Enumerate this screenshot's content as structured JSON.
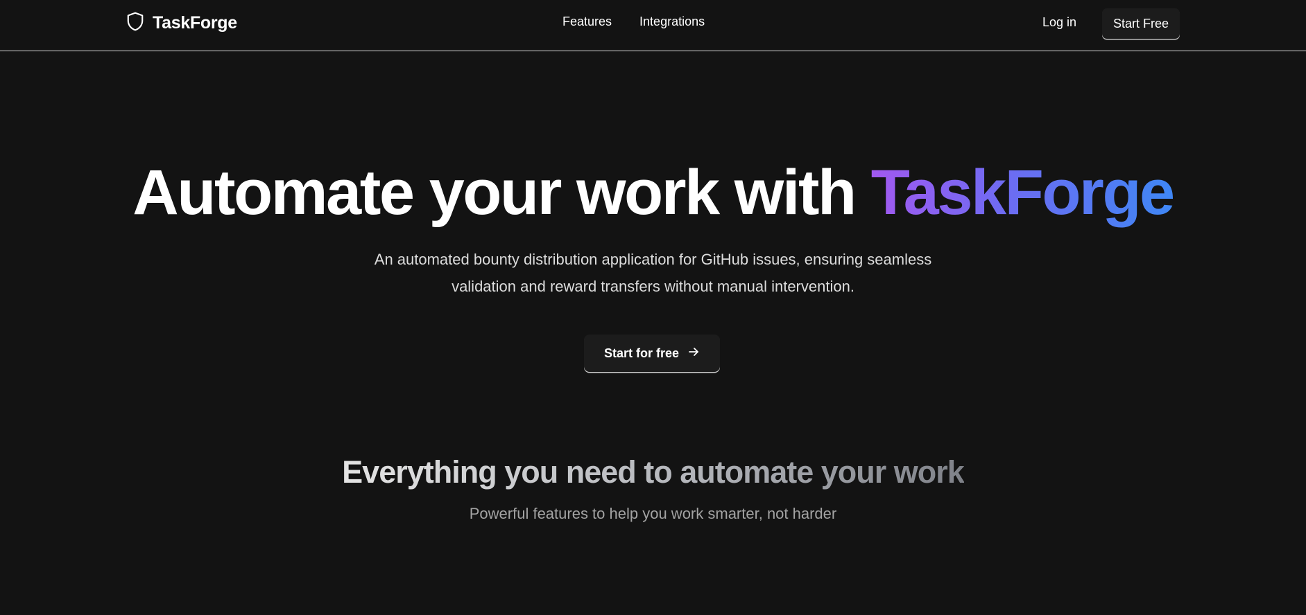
{
  "brand": {
    "name": "TaskForge",
    "icon": "shield-icon"
  },
  "nav": {
    "links": [
      "Features",
      "Integrations"
    ],
    "login_label": "Log in",
    "start_free_label": "Start Free"
  },
  "hero": {
    "title_prefix": "Automate your work with ",
    "title_highlight": "TaskForge",
    "subtitle": "An automated bounty distribution application for GitHub issues, ensuring seamless validation and reward transfers without manual intervention.",
    "cta_label": "Start for free",
    "cta_icon": "arrow-right-icon"
  },
  "features_section": {
    "title": "Everything you need to automate your work",
    "subtitle": "Powerful features to help you work smarter, not harder"
  },
  "colors": {
    "background": "#131313",
    "gradient_start": "#a259f0",
    "gradient_end": "#3f87f5"
  }
}
